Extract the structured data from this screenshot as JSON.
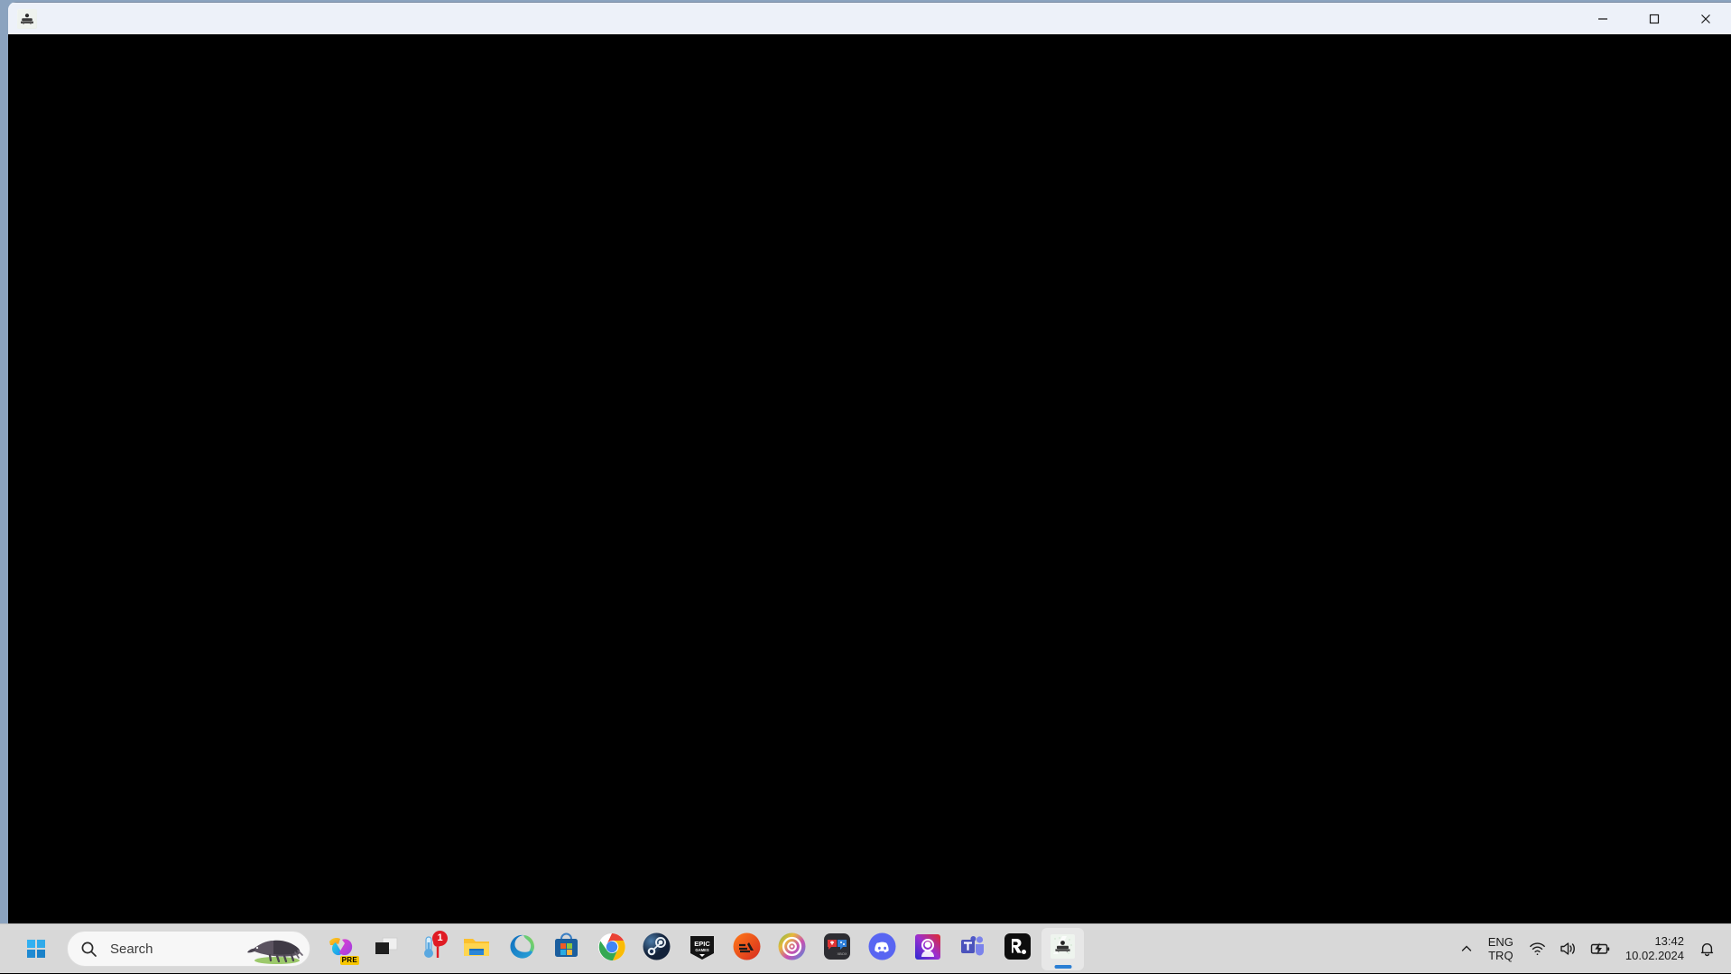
{
  "window": {
    "title": "",
    "icon_name": "app-icon",
    "content_background": "#000000",
    "titlebar_background": "#edf1f9",
    "border_color": "#8ba3bf",
    "controls": {
      "minimize_label": "Minimize",
      "maximize_label": "Maximize",
      "close_label": "Close"
    }
  },
  "taskbar": {
    "background": "#d8d8d8",
    "start": {
      "label": "Start",
      "icon": "windows-logo-icon"
    },
    "search": {
      "placeholder": "Search",
      "value": "",
      "icon": "search-icon",
      "illustration": "anteater-icon"
    },
    "items": [
      {
        "name": "copilot",
        "label": "Copilot",
        "icon": "copilot-icon",
        "badge": "PRE",
        "active": false
      },
      {
        "name": "task-view",
        "label": "Task View",
        "icon": "task-view-icon",
        "badge": "",
        "active": false
      },
      {
        "name": "weather",
        "label": "Weather",
        "icon": "weather-thermometer-icon",
        "badge": "1",
        "active": false
      },
      {
        "name": "file-explorer",
        "label": "File Explorer",
        "icon": "folder-icon",
        "badge": "",
        "active": false
      },
      {
        "name": "microsoft-edge",
        "label": "Microsoft Edge",
        "icon": "edge-icon",
        "badge": "",
        "active": false
      },
      {
        "name": "microsoft-store",
        "label": "Microsoft Store",
        "icon": "store-icon",
        "badge": "",
        "active": false
      },
      {
        "name": "google-chrome",
        "label": "Google Chrome",
        "icon": "chrome-icon",
        "badge": "",
        "active": false
      },
      {
        "name": "steam",
        "label": "Steam",
        "icon": "steam-icon",
        "badge": "",
        "active": false
      },
      {
        "name": "epic-games",
        "label": "Epic Games Launcher",
        "icon": "epic-games-icon",
        "badge": "",
        "active": false
      },
      {
        "name": "ea-app",
        "label": "EA app",
        "icon": "ea-icon",
        "badge": "",
        "active": false
      },
      {
        "name": "ubisoft-connect",
        "label": "Ubisoft Connect",
        "icon": "ubisoft-icon",
        "badge": "",
        "active": false
      },
      {
        "name": "xbox-game-bar",
        "label": "Xbox Game Bar",
        "icon": "game-bar-icon",
        "badge": "",
        "active": false
      },
      {
        "name": "discord",
        "label": "Discord",
        "icon": "discord-icon",
        "badge": "",
        "active": false
      },
      {
        "name": "media-app",
        "label": "Media App",
        "icon": "person-portrait-icon",
        "badge": "",
        "active": false
      },
      {
        "name": "microsoft-teams",
        "label": "Microsoft Teams",
        "icon": "teams-icon",
        "badge": "",
        "active": false
      },
      {
        "name": "rockstar-games",
        "label": "Rockstar Games Launcher",
        "icon": "rockstar-icon",
        "badge": "",
        "active": false
      },
      {
        "name": "active-app",
        "label": "Active Application",
        "icon": "app-icon",
        "badge": "",
        "active": true
      }
    ],
    "tray": {
      "chevron_label": "Show hidden icons",
      "language_primary": "ENG",
      "language_secondary": "TRQ",
      "wifi_label": "Network",
      "volume_label": "Volume",
      "battery_label": "Battery charging",
      "time": "13:42",
      "date": "10.02.2024",
      "notifications_label": "Notifications"
    }
  }
}
